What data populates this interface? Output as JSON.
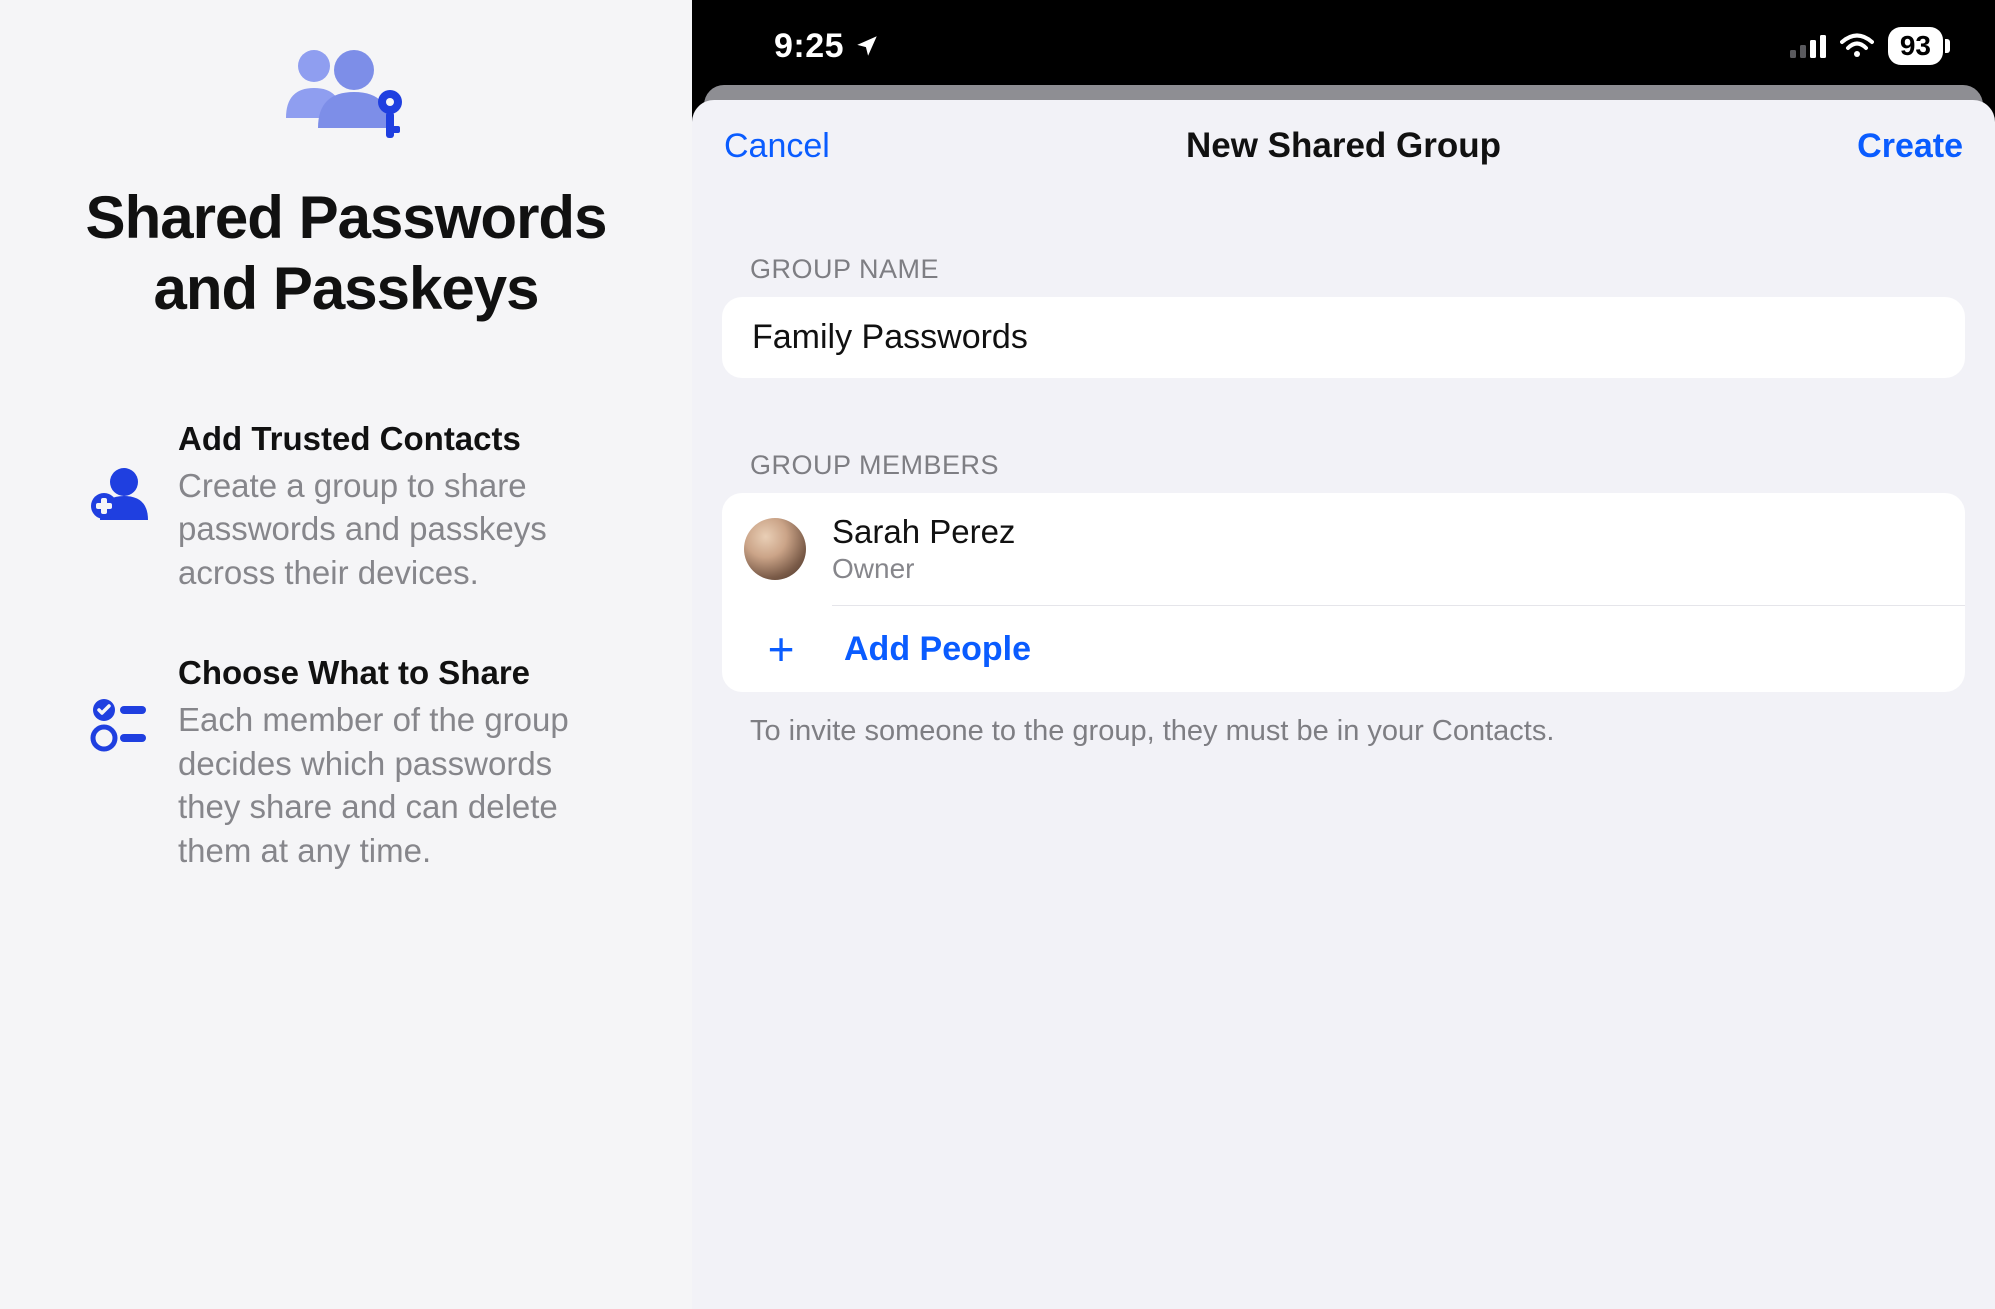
{
  "left": {
    "title": "Shared Passwords and Passkeys",
    "features": [
      {
        "title": "Add Trusted Contacts",
        "desc": "Create a group to share passwords and passkeys across their devices."
      },
      {
        "title": "Choose What to Share",
        "desc": "Each member of the group decides which passwords they share and can delete them at any time."
      }
    ]
  },
  "right": {
    "status": {
      "time": "9:25",
      "battery": "93"
    },
    "sheet": {
      "cancel": "Cancel",
      "title": "New Shared Group",
      "create": "Create",
      "group_name_label": "GROUP NAME",
      "group_name_value": "Family Passwords",
      "members_label": "GROUP MEMBERS",
      "member": {
        "name": "Sarah Perez",
        "role": "Owner"
      },
      "add_people": "Add People",
      "footer": "To invite someone to the group, they must be in your Contacts."
    }
  }
}
